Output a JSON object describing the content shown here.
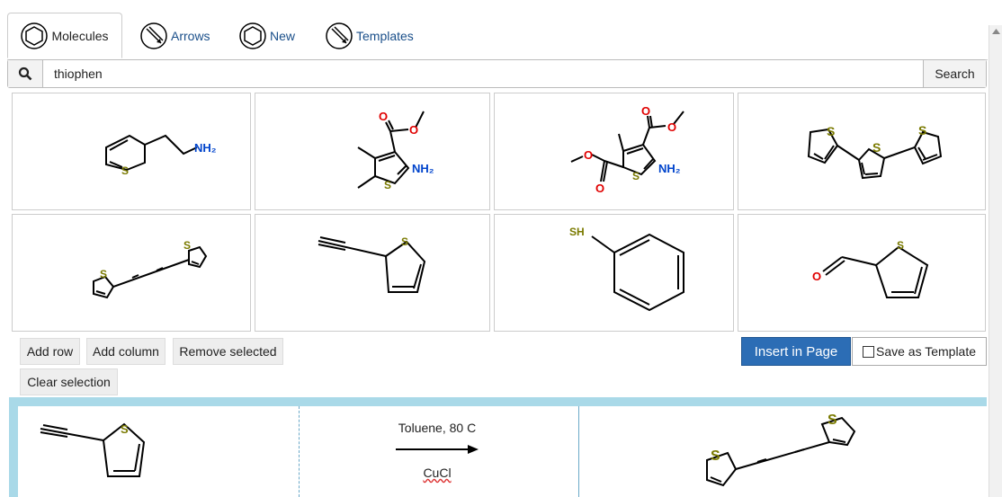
{
  "tabs": [
    {
      "label": "Molecules",
      "active": true
    },
    {
      "label": "Arrows"
    },
    {
      "label": "New"
    },
    {
      "label": "Templates"
    }
  ],
  "search": {
    "value": "thiophen",
    "button": "Search"
  },
  "buttons": {
    "add_row": "Add row",
    "add_column": "Add column",
    "remove_selected": "Remove selected",
    "clear_selection": "Clear selection",
    "insert": "Insert in Page",
    "save_template": "Save as Template"
  },
  "atoms": {
    "S": "S",
    "O": "O",
    "NH2": "NH₂",
    "SH": "SH"
  },
  "reaction": {
    "condition_top": "Toluene, 80 C",
    "condition_bottom": "CuCl"
  }
}
